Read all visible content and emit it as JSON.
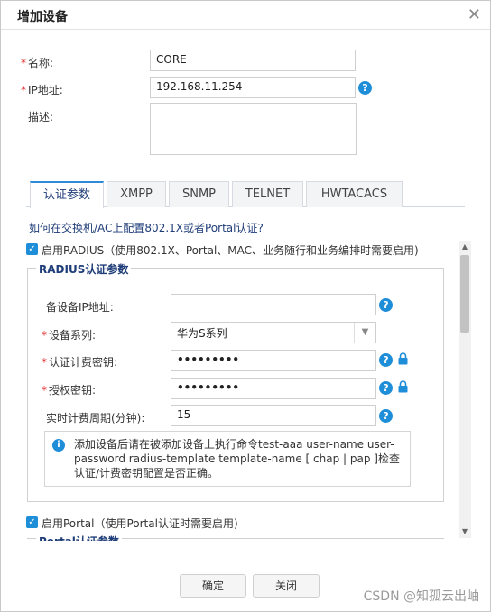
{
  "dialog": {
    "title": "增加设备"
  },
  "form": {
    "name_label": "名称:",
    "name_value": "CORE",
    "ip_label": "IP地址:",
    "ip_value": "192.168.11.254",
    "desc_label": "描述:"
  },
  "tabs": [
    "认证参数",
    "XMPP",
    "SNMP",
    "TELNET",
    "HWTACACS"
  ],
  "auth": {
    "config_link": "如何在交换机/AC上配置802.1X或者Portal认证?",
    "radius_checkbox": "启用RADIUS（使用802.1X、Portal、MAC、业务随行和业务编排时需要启用)",
    "radius_legend": "RADIUS认证参数",
    "backup_ip_label": "备设备IP地址:",
    "device_series_label": "设备系列:",
    "device_series_value": "华为S系列",
    "auth_key_label": "认证计费密钥:",
    "auth_key_value": "•••••••••",
    "authz_key_label": "授权密钥:",
    "authz_key_value": "•••••••••",
    "acct_interval_label": "实时计费周期(分钟):",
    "acct_interval_value": "15",
    "info_text": "添加设备后请在被添加设备上执行命令test-aaa user-name user-password radius-template template-name [ chap | pap ]检查认证/计费密钥配置是否正确。",
    "portal_checkbox": "启用Portal（使用Portal认证时需要启用)",
    "portal_legend": "Portal认证参数"
  },
  "buttons": {
    "ok": "确定",
    "close": "关闭"
  },
  "watermark": "CSDN @知孤云出岫",
  "colors": {
    "accent": "#1f8ed8",
    "link": "#1f3d78",
    "required": "#e02020"
  }
}
